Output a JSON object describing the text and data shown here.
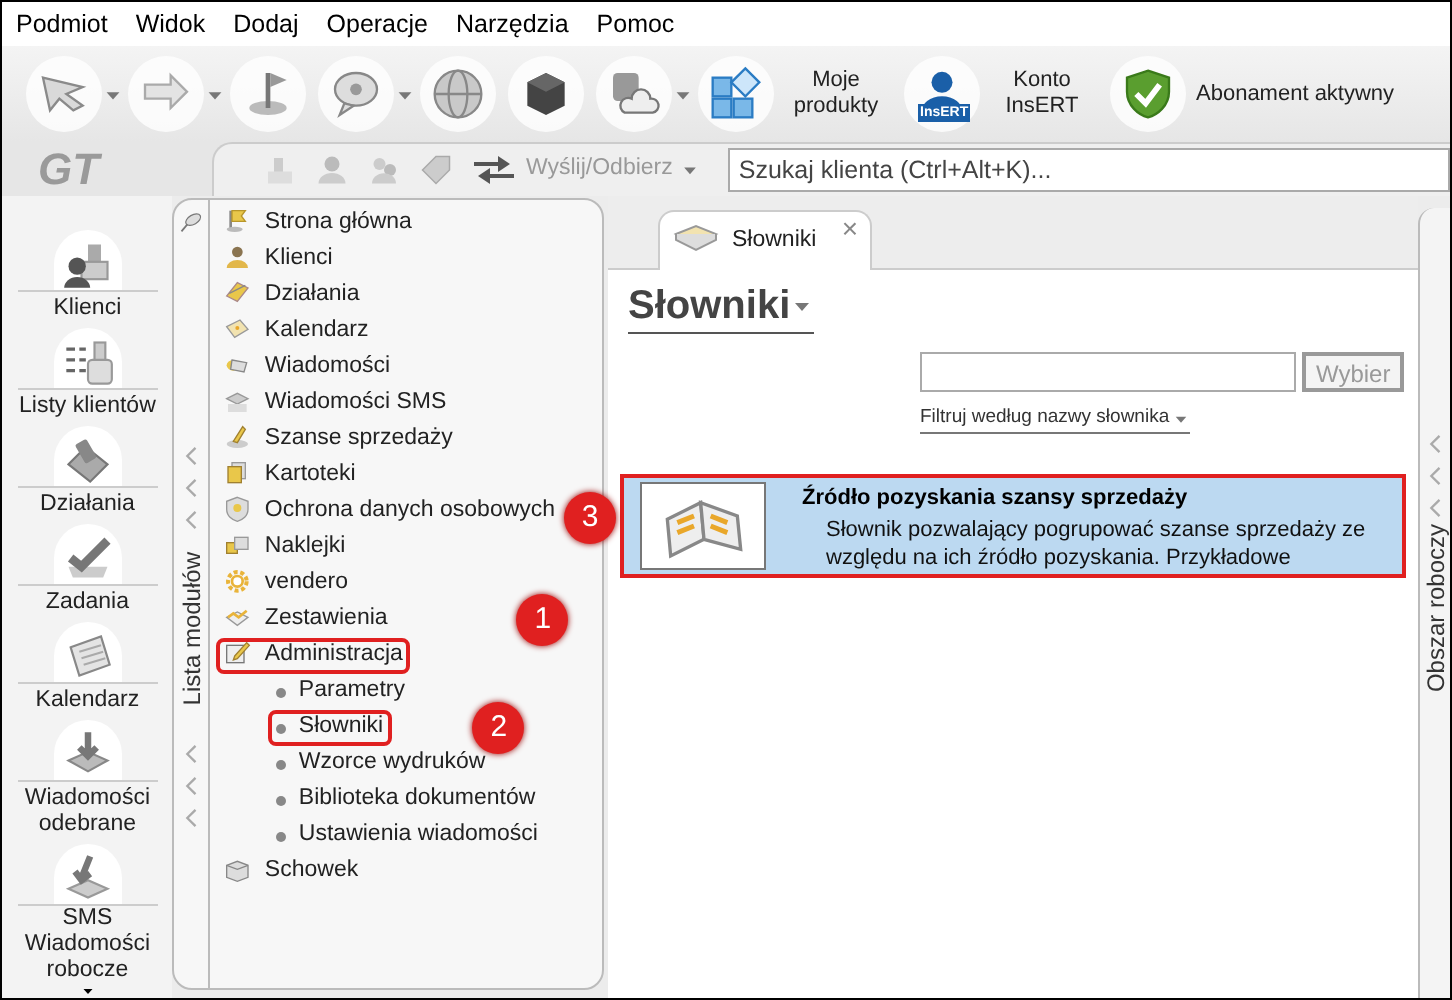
{
  "menu": [
    "Podmiot",
    "Widok",
    "Dodaj",
    "Operacje",
    "Narzędzia",
    "Pomoc"
  ],
  "toolbar": [
    {
      "kind": "icon",
      "dropdown": true
    },
    {
      "kind": "icon",
      "dropdown": true
    },
    {
      "kind": "icon",
      "dropdown": false
    },
    {
      "kind": "icon",
      "dropdown": true
    },
    {
      "kind": "icon",
      "dropdown": false
    },
    {
      "kind": "icon",
      "dropdown": false
    },
    {
      "kind": "icon",
      "dropdown": true
    },
    {
      "kind": "labeled",
      "label": "Moje produkty"
    },
    {
      "kind": "labeled",
      "badge": "InsERT",
      "label": "Konto InsERT"
    },
    {
      "kind": "labeled",
      "label": "Abonament aktywny"
    }
  ],
  "logo": "GT",
  "subtoolbar": {
    "send_receive": "Wyślij/Odbierz",
    "search_placeholder": "Szukaj klienta (Ctrl+Alt+K)..."
  },
  "nav": [
    {
      "lines": [
        "Klienci"
      ]
    },
    {
      "lines": [
        "Listy klientów"
      ]
    },
    {
      "lines": [
        "Działania"
      ]
    },
    {
      "lines": [
        "Zadania"
      ]
    },
    {
      "lines": [
        "Kalendarz"
      ]
    },
    {
      "lines": [
        "Wiadomości",
        "odebrane"
      ]
    },
    {
      "lines": [
        "Wiadomości",
        "robocze"
      ],
      "badge": "SMS"
    }
  ],
  "modules": {
    "vertical_label": "Lista modułów",
    "items": [
      {
        "label": "Strona główna",
        "highlighted": false
      },
      {
        "label": "Klienci",
        "highlighted": false
      },
      {
        "label": "Działania",
        "highlighted": false
      },
      {
        "label": "Kalendarz",
        "highlighted": false
      },
      {
        "label": "Wiadomości",
        "highlighted": false
      },
      {
        "label": "Wiadomości SMS",
        "highlighted": false
      },
      {
        "label": "Szanse sprzedaży",
        "highlighted": false
      },
      {
        "label": "Kartoteki",
        "highlighted": false
      },
      {
        "label": "Ochrona danych osobowych",
        "highlighted": false
      },
      {
        "label": "Naklejki",
        "highlighted": false
      },
      {
        "label": "vendero",
        "highlighted": false
      },
      {
        "label": "Zestawienia",
        "highlighted": false
      },
      {
        "label": "Administracja",
        "highlighted": true,
        "callout": "1",
        "children": [
          {
            "label": "Parametry",
            "highlighted": false
          },
          {
            "label": "Słowniki",
            "highlighted": true,
            "callout": "2"
          },
          {
            "label": "Wzorce wydruków",
            "highlighted": false
          },
          {
            "label": "Biblioteka dokumentów",
            "highlighted": false
          },
          {
            "label": "Ustawienia wiadomości",
            "highlighted": false
          }
        ]
      },
      {
        "label": "Schowek",
        "highlighted": false
      }
    ]
  },
  "tabs": [
    {
      "label": "Słowniki",
      "close": "×",
      "selected": true
    }
  ],
  "page": {
    "title": "Słowniki",
    "search_button": "Wybier",
    "filter_link": "Filtruj według nazwy słownika"
  },
  "dictionaries": [
    {
      "title": "Źródło pozyskania szansy sprzedaży",
      "description": "Słownik pozwalający pogrupować szanse sprzedaży ze względu na ich źródło pozyskania. Przykładowe",
      "highlighted": true,
      "selected": true,
      "callout": "3"
    }
  ],
  "workspace": {
    "vertical_label": "Obszar roboczy"
  }
}
